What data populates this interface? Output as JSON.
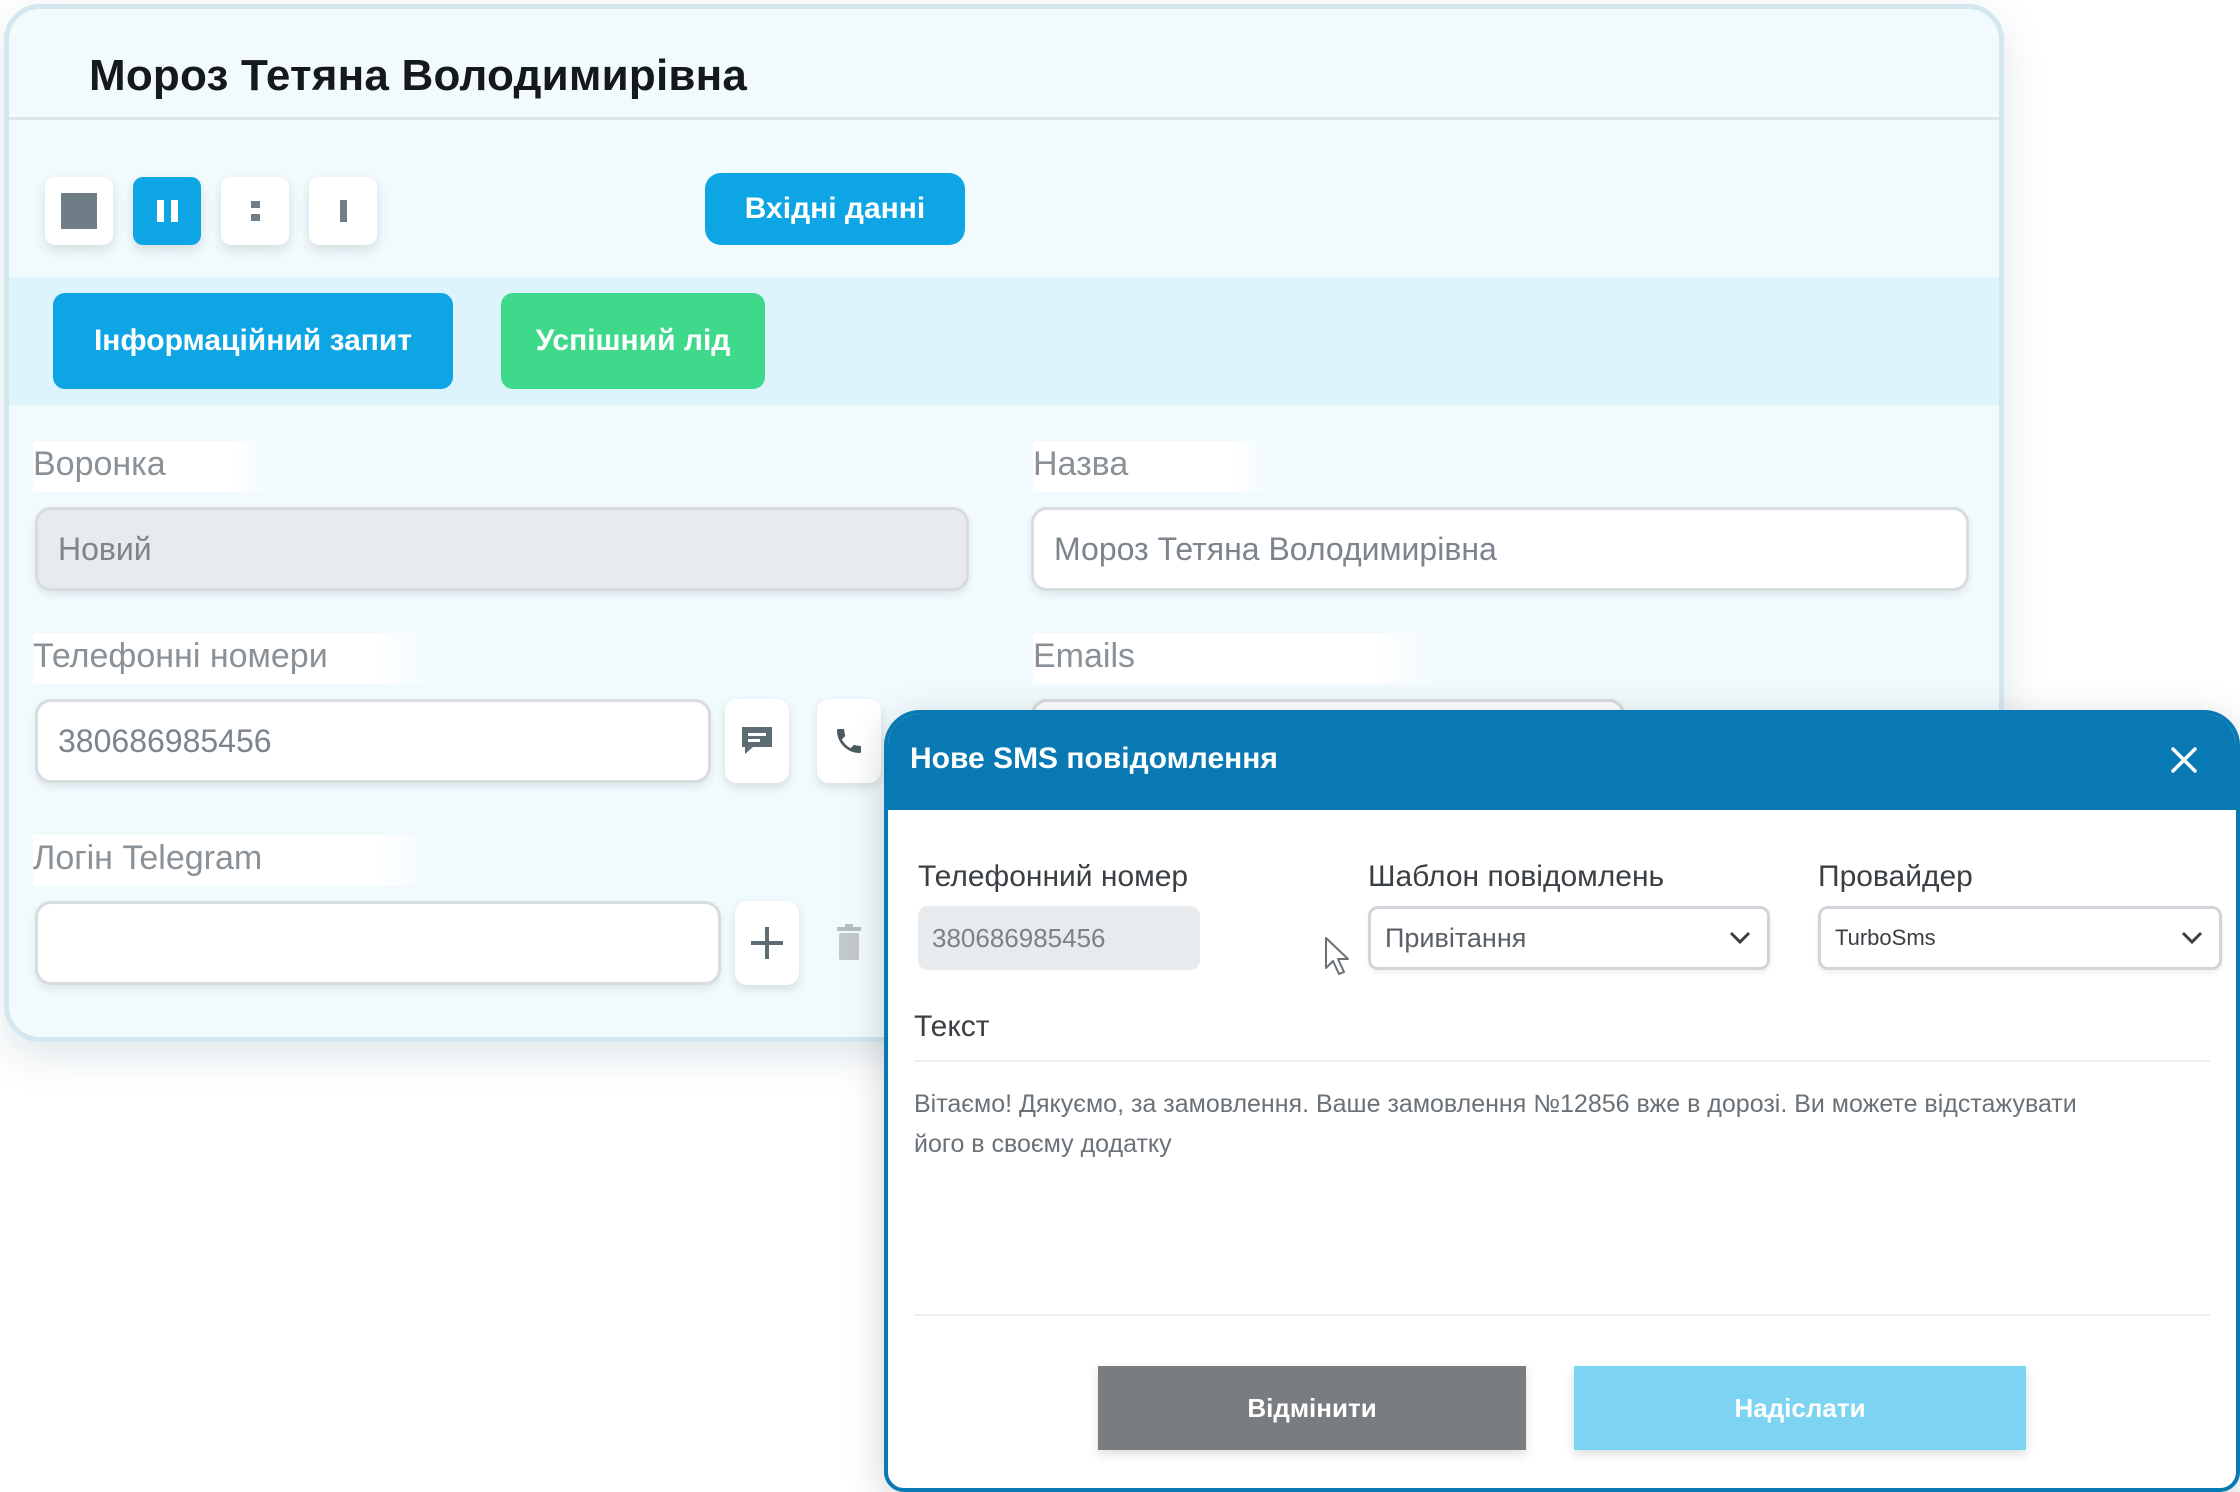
{
  "card": {
    "title": "Мороз Тетяна Володимирівна",
    "input_data_button": "Вхідні данні",
    "stages": [
      "Інформаційний запит",
      "Успішний лід"
    ],
    "funnel": {
      "label": "Воронка",
      "value": "Новий"
    },
    "name": {
      "label": "Назва",
      "value": "Мороз Тетяна Володимирівна"
    },
    "phones": {
      "label": "Телефонні номери",
      "value": "380686985456"
    },
    "emails": {
      "label": "Emails",
      "value": ""
    },
    "telegram": {
      "label": "Логін Telegram",
      "value": ""
    }
  },
  "sms_modal": {
    "title": "Нове SMS повідомлення",
    "phone": {
      "label": "Телефонний номер",
      "value": "380686985456"
    },
    "template": {
      "label": "Шаблон повідомлень",
      "value": "Привітання"
    },
    "provider": {
      "label": "Провайдер",
      "value": "TurboSms"
    },
    "text": {
      "label": "Текст",
      "value": "Вітаємо! Дякуємо, за замовлення. Ваше замовлення №12856 вже в дорозі. Ви можете відстажувати його в своєму додатку"
    },
    "cancel_label": "Відмінити",
    "send_label": "Надіслати"
  },
  "colors": {
    "accent": "#0ea5e4",
    "success": "#3fd98c",
    "modal_header": "#0879b3",
    "card_bg": "#f1fbfe",
    "stage_strip": "#ddf4fc"
  },
  "icons": [
    "stop-icon",
    "pause-icon",
    "dots-icon",
    "bar-icon",
    "message-icon",
    "phone-icon",
    "plus-icon",
    "trash-icon",
    "close-icon",
    "chevron-down-icon",
    "mouse-cursor-icon"
  ]
}
